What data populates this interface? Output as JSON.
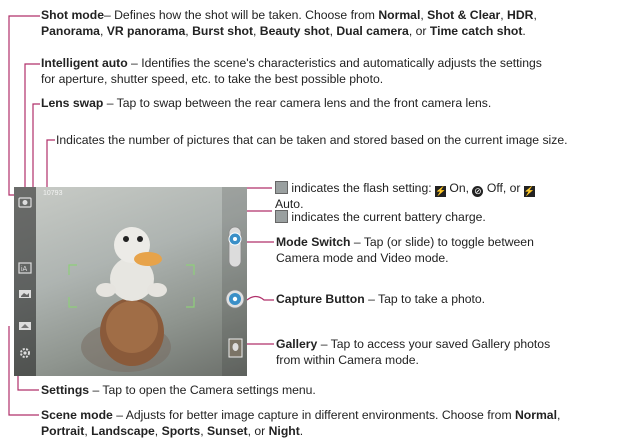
{
  "callouts": {
    "shot_mode": {
      "term": "Shot mode",
      "desc": "– Defines how the shot will be taken. Choose from ",
      "options": [
        "Normal",
        "Shot & Clear",
        "HDR",
        "Panorama",
        "VR panorama",
        "Burst shot",
        "Beauty shot",
        "Dual camera",
        "Time catch shot"
      ],
      "sep": ", ",
      "or": "or "
    },
    "intelligent_auto": {
      "term": "Intelligent auto",
      "line1": " – Identifies the scene's characteristics and automatically adjusts the settings",
      "line2": "for aperture, shutter speed, etc. to take the best possible photo."
    },
    "lens_swap": {
      "term": "Lens swap",
      "desc": " – Tap to swap between the rear camera lens and the front camera lens."
    },
    "picture_count": {
      "desc": "Indicates the number of pictures that can be taken and stored based on the current image size."
    },
    "flash": {
      "desc": " indicates the flash setting: ",
      "on": "On,",
      "off": "Off, or",
      "auto": "Auto."
    },
    "battery": {
      "desc": " indicates the current battery charge."
    },
    "mode_switch": {
      "term": "Mode Switch",
      "line1": " – Tap (or slide) to toggle between",
      "line2": "Camera mode and Video mode."
    },
    "capture": {
      "term": "Capture Button",
      "desc": " – Tap to take a photo."
    },
    "gallery": {
      "term": "Gallery",
      "line1": " – Tap to access your saved Gallery photos",
      "line2": "from within Camera mode."
    },
    "settings": {
      "term": "Settings",
      "desc": " – Tap to open the Camera settings menu."
    },
    "scene_mode": {
      "term": "Scene mode",
      "desc": " – Adjusts for better image capture in different environments. Choose from ",
      "options": [
        "Normal",
        "Portrait",
        "Landscape",
        "Sports",
        "Sunset",
        "Night"
      ],
      "sep": ", ",
      "or": "or "
    }
  },
  "camera": {
    "shot_count": "10793"
  },
  "colors": {
    "leader_line": "#b0306a",
    "accent_button": "#3a8fc7"
  },
  "icons": [
    "flash-icon",
    "flash-on-icon",
    "flash-off-icon",
    "flash-auto-icon",
    "battery-icon",
    "shot-mode-icon",
    "intelligent-auto-icon",
    "lens-swap-icon",
    "scene-mode-icon",
    "settings-icon",
    "mode-switch-icon",
    "capture-button-icon",
    "gallery-thumbnail-icon"
  ]
}
